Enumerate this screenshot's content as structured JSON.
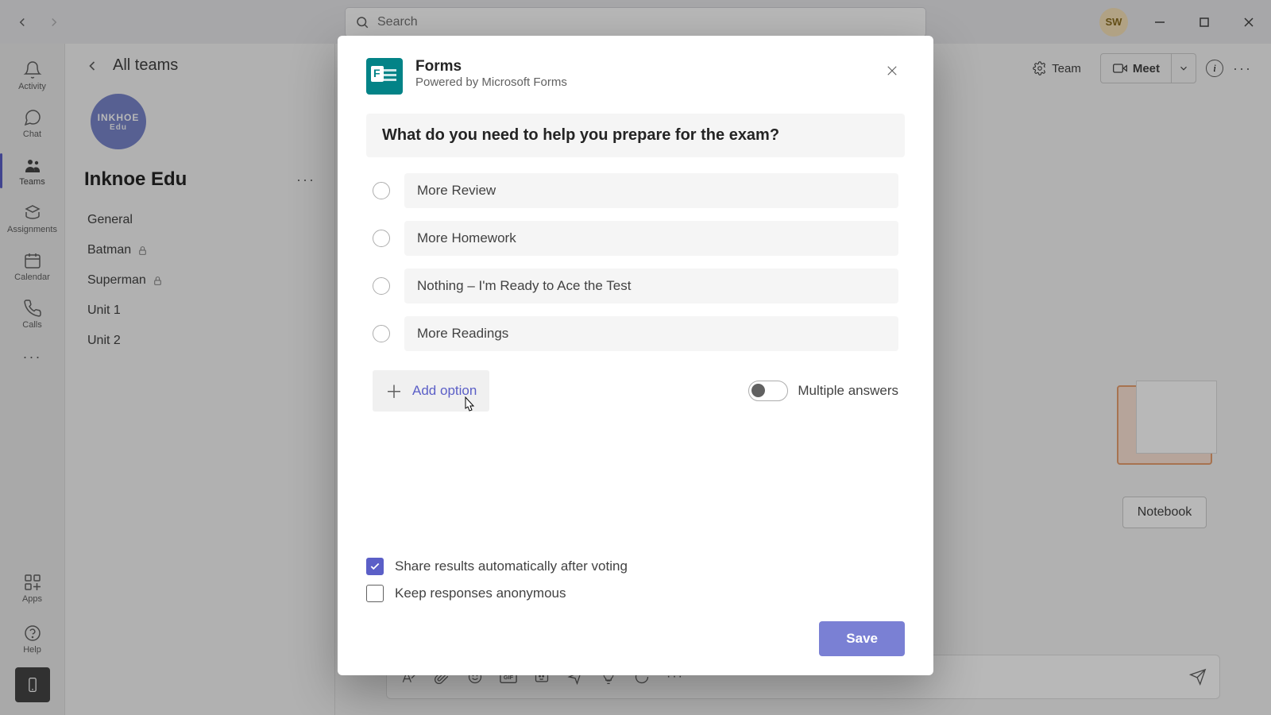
{
  "titlebar": {
    "search_placeholder": "Search",
    "avatar_initials": "SW"
  },
  "rail": {
    "activity": "Activity",
    "chat": "Chat",
    "teams": "Teams",
    "assignments": "Assignments",
    "calendar": "Calendar",
    "calls": "Calls",
    "apps": "Apps",
    "help": "Help"
  },
  "panel": {
    "all_teams": "All teams",
    "team_avatar_line1": "INKHOE",
    "team_avatar_line2": "Edu",
    "team_name": "Inknoe Edu",
    "channels": [
      {
        "name": "General",
        "locked": false
      },
      {
        "name": "Batman",
        "locked": true
      },
      {
        "name": "Superman",
        "locked": true
      },
      {
        "name": "Unit 1",
        "locked": false
      },
      {
        "name": "Unit 2",
        "locked": false
      }
    ]
  },
  "header": {
    "team": "Team",
    "meet": "Meet"
  },
  "notebook": {
    "label": "Notebook"
  },
  "modal": {
    "title": "Forms",
    "subtitle": "Powered by Microsoft Forms",
    "question": "What do you need to help you prepare for the exam?",
    "options": [
      "More Review",
      "More Homework",
      "Nothing – I'm Ready to Ace the Test",
      "More Readings"
    ],
    "add_option": "Add option",
    "multiple_answers": "Multiple answers",
    "share_results": "Share results automatically after voting",
    "keep_anonymous": "Keep responses anonymous",
    "save": "Save"
  }
}
